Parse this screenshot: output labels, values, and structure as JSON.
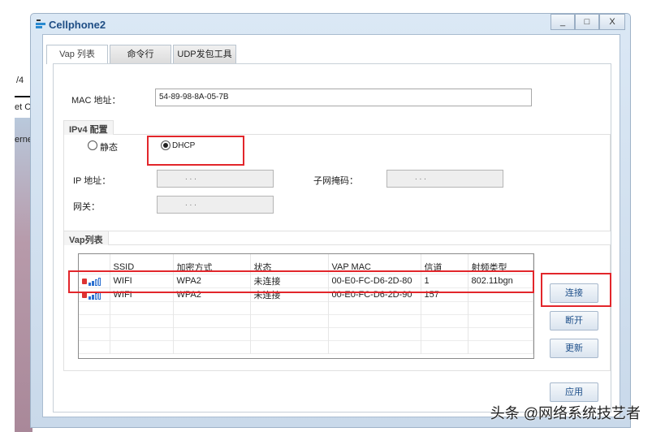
{
  "background": {
    "texts": [
      "/4",
      "et C",
      "erne"
    ]
  },
  "window": {
    "title": "Cellphone2",
    "controls": {
      "minimize": "_",
      "maximize": "□",
      "close": "X"
    }
  },
  "tabs": [
    {
      "label": "Vap 列表",
      "active": true
    },
    {
      "label": "命令行"
    },
    {
      "label": "UDP发包工具"
    }
  ],
  "mac": {
    "label": "MAC 地址：",
    "value": "54-89-98-8A-05-7B"
  },
  "ipv4": {
    "title": "IPv4 配置",
    "static_label": "静态",
    "dhcp_label": "DHCP",
    "selected": "DHCP",
    "ip_label": "IP 地址：",
    "mask_label": "子网掩码：",
    "gateway_label": "网关：",
    "ip_dots": ".   .   ."
  },
  "vap": {
    "title": "Vap列表",
    "columns": [
      "",
      "SSID",
      "加密方式",
      "状态",
      "VAP MAC",
      "信道",
      "射频类型"
    ],
    "rows": [
      {
        "ssid": "WIFI",
        "enc": "WPA2",
        "status": "未连接",
        "mac": "00-E0-FC-D6-2D-80",
        "channel": "1",
        "radio": "802.11bgn"
      },
      {
        "ssid": "WIFI",
        "enc": "WPA2",
        "status": "未连接",
        "mac": "00-E0-FC-D6-2D-90",
        "channel": "157",
        "radio": ""
      }
    ],
    "buttons": {
      "connect": "连接",
      "disconnect": "断开",
      "refresh": "更新"
    }
  },
  "apply": "应用",
  "watermark": "头条 @网络系统技艺者",
  "colors": {
    "highlight": "#e2262b",
    "accent": "#1d4f8a"
  }
}
